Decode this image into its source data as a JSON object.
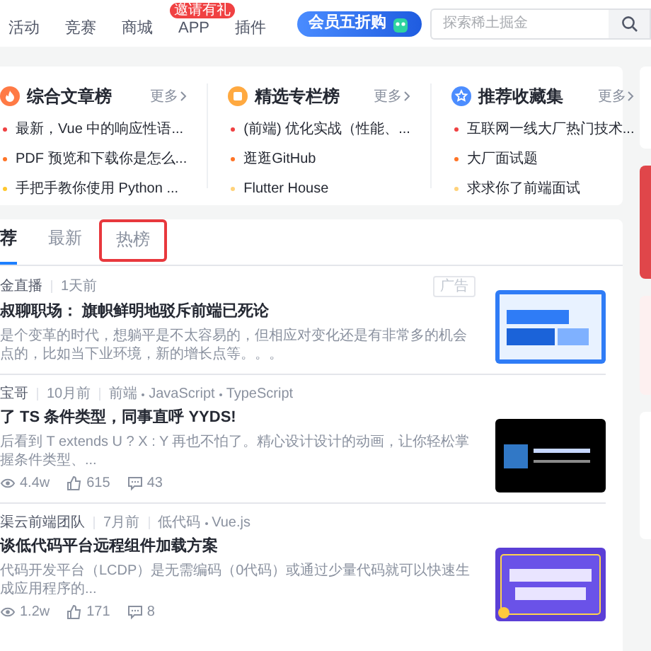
{
  "nav": {
    "items": [
      {
        "label": "活动"
      },
      {
        "label": "竞赛"
      },
      {
        "label": "商城"
      },
      {
        "label": "APP",
        "badge": "邀请有礼"
      },
      {
        "label": "插件"
      }
    ],
    "vip_button": "会员五折购",
    "search": {
      "placeholder": "探索稀土掘金"
    }
  },
  "rankings": [
    {
      "title": "综合文章榜",
      "more": "更多",
      "items": [
        {
          "text": "最新，Vue 中的响应性语...",
          "color": "#f04142"
        },
        {
          "text": "PDF 预览和下载你是怎么...",
          "color": "#ff7426"
        },
        {
          "text": "手把手教你使用 Python ...",
          "color": "#ffc72e"
        }
      ]
    },
    {
      "title": "精选专栏榜",
      "more": "更多",
      "items": [
        {
          "text": "(前端) 优化实战（性能、...",
          "color": "#f04142"
        },
        {
          "text": "逛逛GitHub",
          "color": "#ff7426"
        },
        {
          "text": "Flutter House",
          "color": "#ffd27a"
        }
      ]
    },
    {
      "title": "推荐收藏集",
      "more": "更多",
      "items": [
        {
          "text": "互联网一线大厂热门技术...",
          "color": "#f04142"
        },
        {
          "text": "大厂面试题",
          "color": "#ff7426"
        },
        {
          "text": "求求你了前端面试",
          "color": "#ffd27a"
        }
      ]
    }
  ],
  "tabs": [
    {
      "label": "荐",
      "selected": true,
      "outlined": false
    },
    {
      "label": "最新",
      "selected": false,
      "outlined": false
    },
    {
      "label": "热榜",
      "selected": false,
      "outlined": true
    }
  ],
  "articles": [
    {
      "author": "金直播",
      "time": "1天前",
      "ad": "广告",
      "title": "叔聊职场： 旗帜鲜明地驳斥前端已死论",
      "summary": "是个变革的时代，想躺平是不太容易的，但相应对变化还是有非常多的机会点的，比如当下业环境，新的增长点等。。。"
    },
    {
      "author": "宝哥",
      "time": "10月前",
      "tags": [
        "前端",
        "JavaScript",
        "TypeScript"
      ],
      "title": "了 TS 条件类型，同事直呼 YYDS!",
      "summary": "后看到 T extends U ? X : Y 再也不怕了。精心设计设计的动画，让你轻松掌握条件类型、...",
      "views": "4.4w",
      "likes": "615",
      "comments": "43"
    },
    {
      "author": "渠云前端团队",
      "time": "7月前",
      "tags": [
        "低代码",
        "Vue.js"
      ],
      "title": "谈低代码平台远程组件加载方案",
      "summary": "代码开发平台（LCDP）是无需编码（0代码）或通过少量代码就可以快速生成应用程序的...",
      "views": "1.2w",
      "likes": "171",
      "comments": "8"
    }
  ]
}
